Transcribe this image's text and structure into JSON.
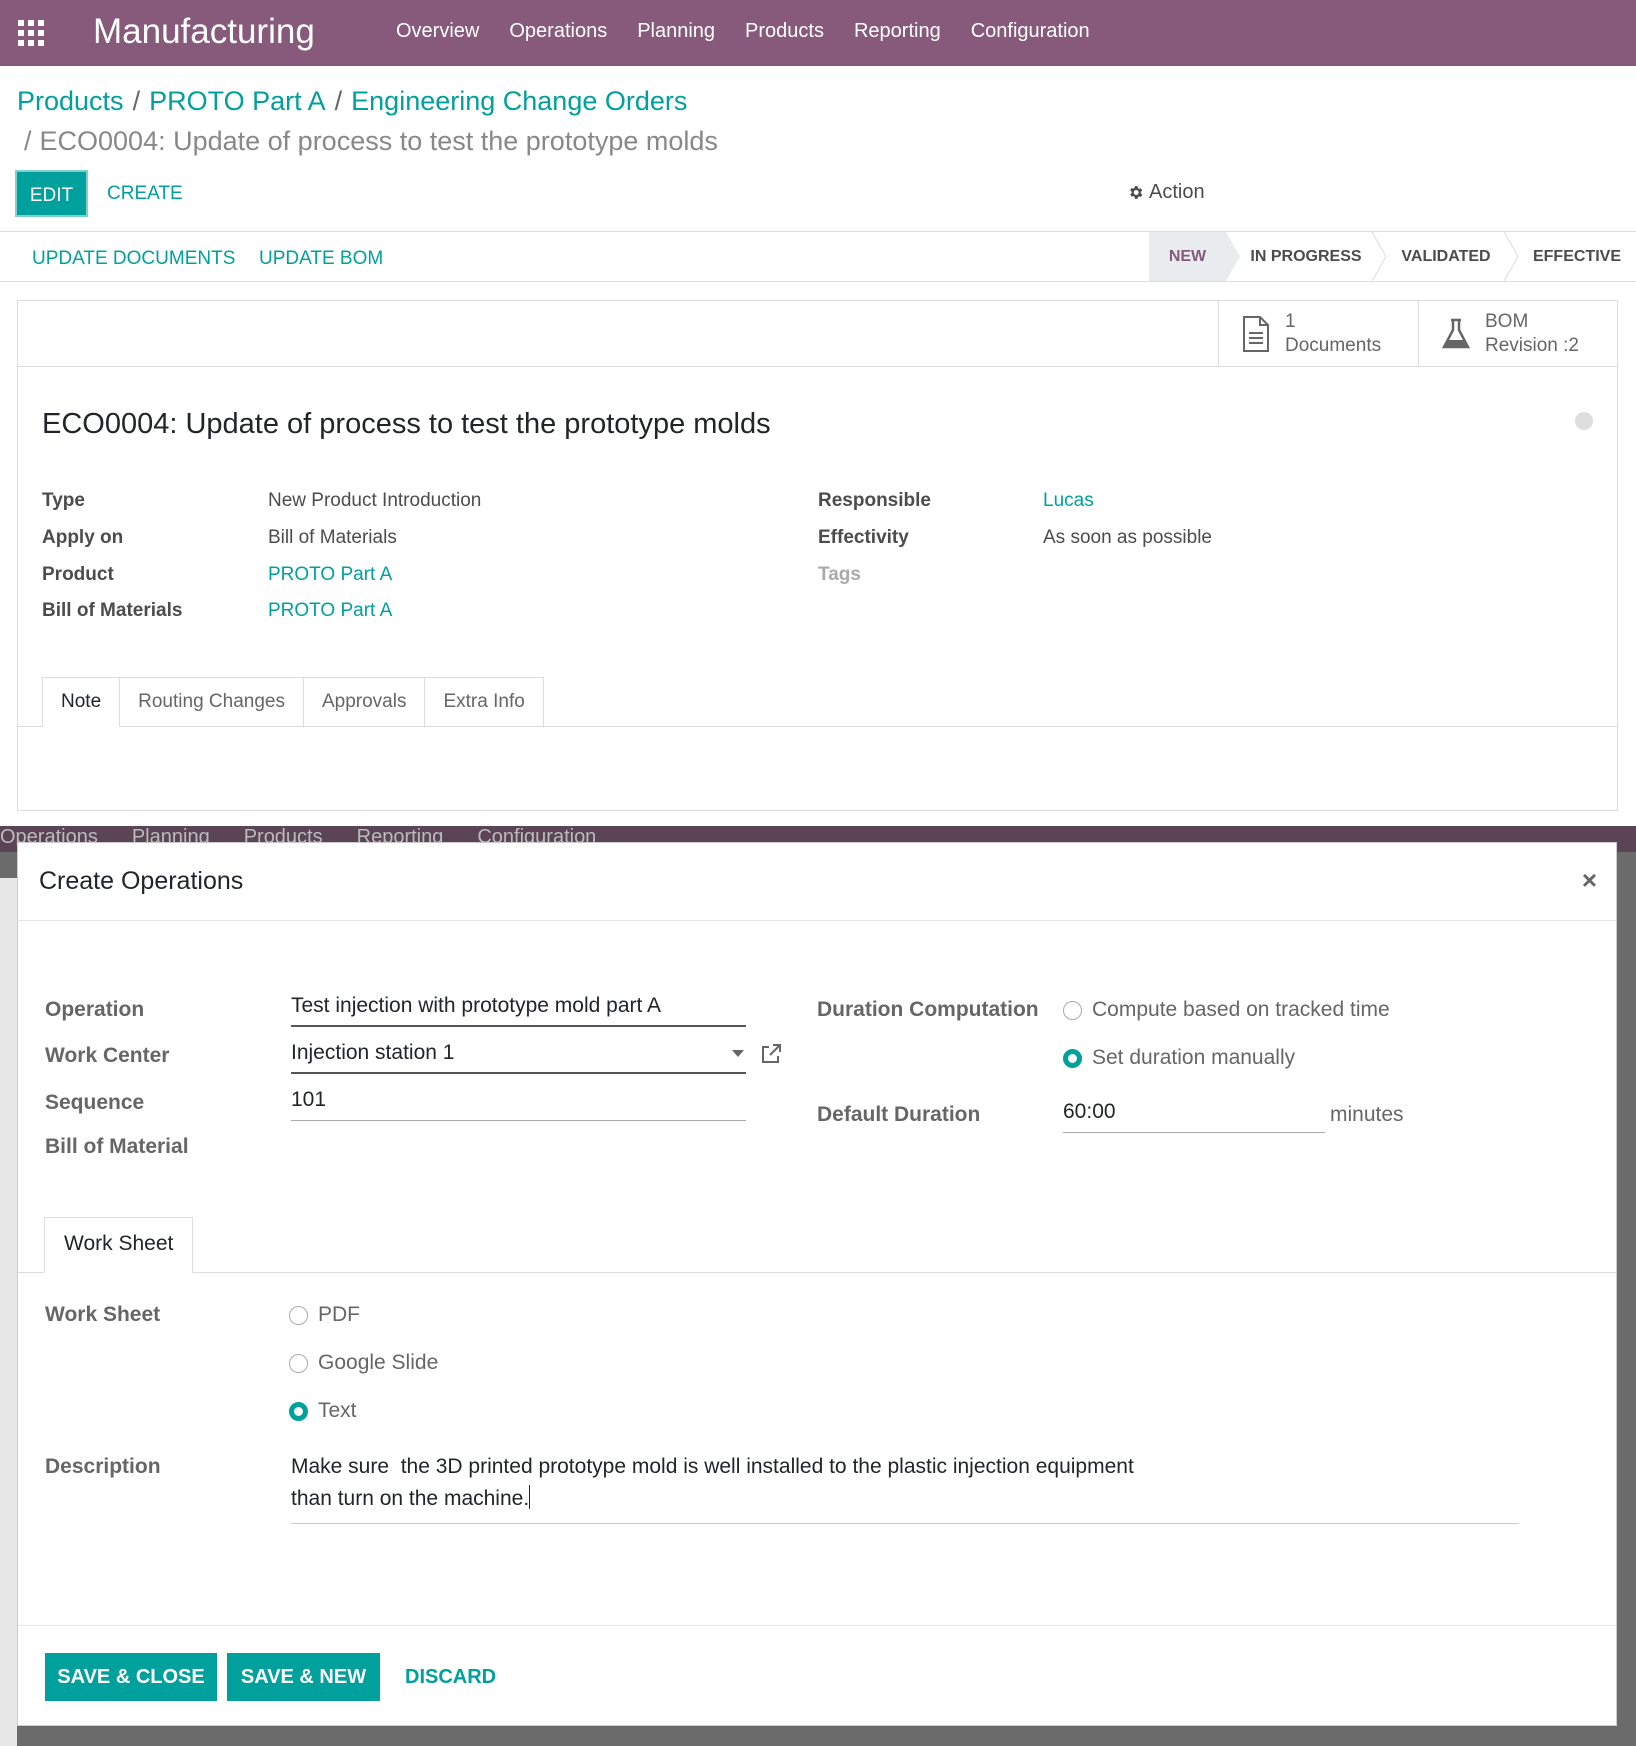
{
  "navbar": {
    "brand": "Manufacturing",
    "menu": [
      "Overview",
      "Operations",
      "Planning",
      "Products",
      "Reporting",
      "Configuration"
    ]
  },
  "breadcrumb": {
    "items": [
      "Products",
      "PROTO Part A",
      "Engineering Change Orders"
    ],
    "current": "ECO0004: Update of process to test the prototype molds"
  },
  "buttons": {
    "edit": "EDIT",
    "create": "CREATE",
    "action": "Action"
  },
  "statusbar": {
    "buttons": [
      "UPDATE DOCUMENTS",
      "UPDATE BOM"
    ],
    "stages": [
      "NEW",
      "IN PROGRESS",
      "VALIDATED",
      "EFFECTIVE"
    ],
    "active_stage": "NEW"
  },
  "smart_buttons": {
    "documents": {
      "count": "1",
      "label": "Documents",
      "icon": "document-icon"
    },
    "bom": {
      "line1": "BOM",
      "line2": "Revision :2",
      "icon": "flask-icon"
    }
  },
  "record": {
    "title": "ECO0004: Update of process to test the prototype molds",
    "left": [
      {
        "label": "Type",
        "value": "New Product Introduction"
      },
      {
        "label": "Apply on",
        "value": "Bill of Materials"
      },
      {
        "label": "Product",
        "value": "PROTO Part A"
      },
      {
        "label": "Bill of Materials",
        "value": "PROTO Part A"
      }
    ],
    "right": [
      {
        "label": "Responsible",
        "value": "Lucas"
      },
      {
        "label": "Effectivity",
        "value": "As soon as possible"
      },
      {
        "label": "Tags",
        "value": ""
      }
    ],
    "tabs": [
      "Note",
      "Routing Changes",
      "Approvals",
      "Extra Info"
    ]
  },
  "background": {
    "menu": [
      "Operations",
      "Planning",
      "Products",
      "Reporting",
      "Configuration"
    ]
  },
  "modal": {
    "title": "Create Operations",
    "close": "×",
    "fields": {
      "operation_label": "Operation",
      "operation_value": "Test injection with prototype mold part A",
      "work_center_label": "Work Center",
      "work_center_value": "Injection station 1",
      "sequence_label": "Sequence",
      "sequence_value": "101",
      "bom_label": "Bill of Material",
      "duration_comp_label": "Duration Computation",
      "duration_opt1": "Compute based on tracked time",
      "duration_opt2": "Set duration manually",
      "default_duration_label": "Default Duration",
      "default_duration_value": "60:00",
      "default_duration_unit": "minutes"
    },
    "tab": "Work Sheet",
    "worksheet": {
      "label": "Work Sheet",
      "options": [
        "PDF",
        "Google Slide",
        "Text"
      ],
      "selected": "Text"
    },
    "description": {
      "label": "Description",
      "line1": "Make sure  the 3D printed prototype mold is well installed to the plastic injection equipment",
      "line2": "than turn on the machine."
    },
    "footer": {
      "save_close": "SAVE & CLOSE",
      "save_new": "SAVE & NEW",
      "discard": "DISCARD"
    }
  },
  "colors": {
    "navbar": "#875a7b",
    "accent": "#00A09D"
  }
}
